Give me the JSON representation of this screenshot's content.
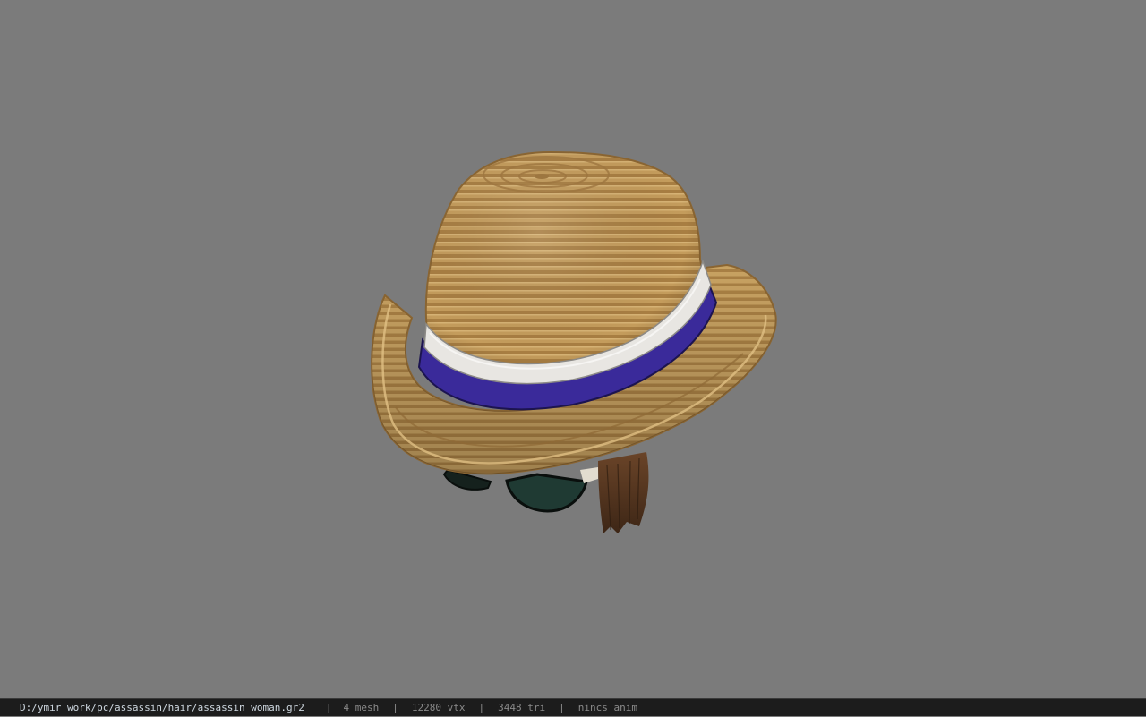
{
  "statusbar": {
    "file_path": "D:/ymir work/pc/assassin/hair/assassin_woman.gr2",
    "separator": "|",
    "mesh_count": "4 mesh",
    "vertex_count": "12280 vtx",
    "triangle_count": "3448 tri",
    "animation": "nincs anim"
  },
  "viewport": {
    "background_color": "#7b7b7b",
    "model": "straw-fedora-hat-with-sunglasses-and-hair"
  },
  "colors": {
    "straw": "#c09a5a",
    "band_white": "#e8e6e2",
    "band_purple": "#3a2a9a",
    "hair": "#5a3a22",
    "lens": "#1f3a33"
  }
}
